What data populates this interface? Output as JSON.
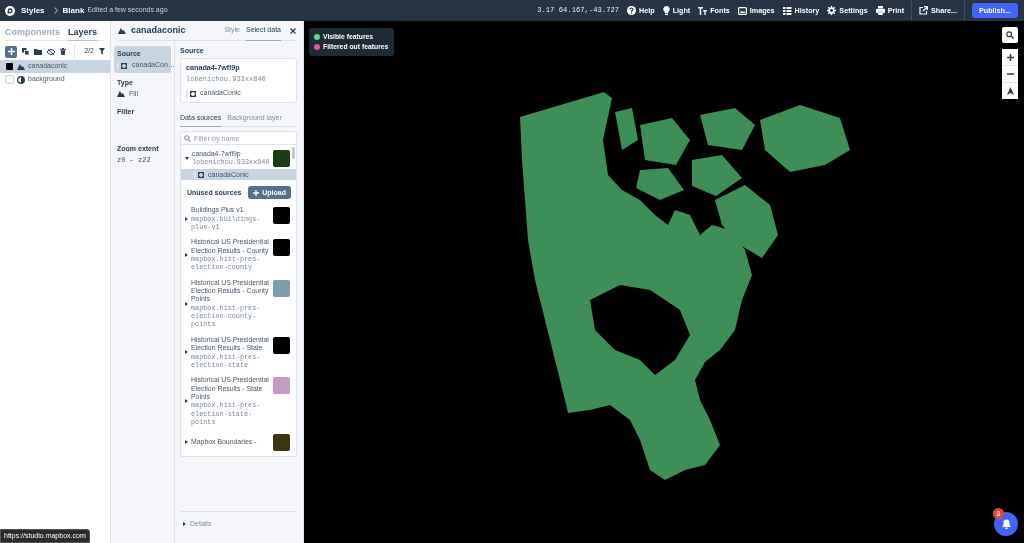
{
  "topbar": {
    "breadcrumbs": [
      {
        "label": "Styles"
      },
      {
        "label": "Blank"
      }
    ],
    "status": "Edited a few seconds ago",
    "map_position": "3.17 64.167,-43.727",
    "menu": [
      {
        "label": "Help",
        "kind": "help"
      },
      {
        "label": "Light",
        "kind": "light"
      },
      {
        "label": "Fonts",
        "kind": "fonts"
      },
      {
        "label": "Images",
        "kind": "images"
      },
      {
        "label": "History",
        "kind": "history"
      },
      {
        "label": "Settings",
        "kind": "settings"
      },
      {
        "label": "Print",
        "kind": "print"
      }
    ],
    "share": "Share...",
    "publish": "Publish..."
  },
  "layers_panel": {
    "tabs": [
      {
        "label": "Components",
        "selected": false
      },
      {
        "label": "Layers",
        "selected": true
      }
    ],
    "count": "2/2",
    "layers": [
      {
        "name": "canadaconic",
        "kind": "fill",
        "selected": true,
        "color": "#000000"
      },
      {
        "name": "background",
        "kind": "background",
        "selected": false,
        "color": "#ffffff"
      }
    ]
  },
  "layer_editor": {
    "title": "canadaconic",
    "tabs": [
      {
        "label": "Style",
        "selected": false
      },
      {
        "label": "Select data",
        "selected": true
      }
    ],
    "sections": [
      {
        "label": "Source",
        "value": "canadaCon…",
        "kind": "source",
        "selected": true
      },
      {
        "label": "Type",
        "value": "Fill",
        "kind": "type",
        "selected": false
      },
      {
        "label": "Filter",
        "kind": "filter",
        "selected": false
      },
      {
        "label": "Zoom extent",
        "value": "z0 – z22",
        "kind": "zoom",
        "selected": false
      }
    ],
    "source": {
      "heading": "Source",
      "name": "canada4-7wfl9p",
      "id": "lobenichou.933xx840",
      "layer": "canadaConic"
    },
    "data_tabs": [
      {
        "label": "Data sources",
        "selected": true
      },
      {
        "label": "Background layer",
        "selected": false
      }
    ],
    "filter": {
      "placeholder": "Filter by name"
    },
    "active_sources": [
      {
        "name": "canada4-7wfl9p",
        "id": "lobenichou.933xx840",
        "expanded": true,
        "color": "#1c3a14",
        "layers": [
          {
            "name": "canadaConic",
            "selected": true
          }
        ]
      }
    ],
    "unused_heading": "Unused sources",
    "upload": "Upload",
    "unused_sources": [
      {
        "name": "Buildings Plus v1",
        "id": "mapbox.buildings-plus-v1",
        "expanded": false,
        "color": "#000000"
      },
      {
        "name": "Historical US Presidential Election Results - County",
        "id": "mapbox.hist-pres-election-county",
        "expanded": false,
        "color": "#000000"
      },
      {
        "name": "Historical US Presidential Election Results - County Points",
        "id": "mapbox.hist-pres-election-county-points",
        "expanded": false,
        "color": "#7d9dad"
      },
      {
        "name": "Historical US Presidential Election Results - State",
        "id": "mapbox.hist-pres-election-state",
        "expanded": false,
        "color": "#000000"
      },
      {
        "name": "Historical US Presidential Election Results - State Points",
        "id": "mapbox.hist-pres-election-state-points",
        "expanded": false,
        "color": "#c49ac6"
      },
      {
        "name": "Mapbox Boundaries -",
        "expanded": false,
        "color": "#3a3512"
      }
    ],
    "details": "Details"
  },
  "map": {
    "legend": [
      {
        "label": "Visible features",
        "color": "#4fe08f"
      },
      {
        "label": "Filtered out features",
        "color": "#e2578f"
      }
    ],
    "notifications": "3"
  },
  "url_tooltip": "https://studio.mapbox.com"
}
